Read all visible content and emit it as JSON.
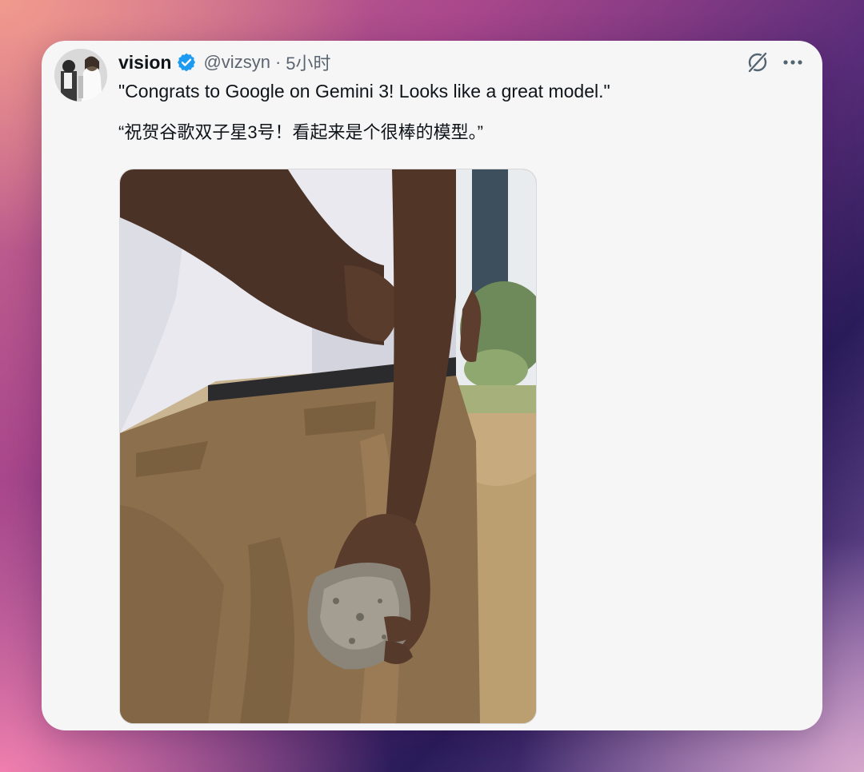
{
  "tweet": {
    "author": {
      "display_name": "vision",
      "handle": "@vizsyn",
      "verified": true
    },
    "separator": "·",
    "time": "5小时",
    "text_en": "\"Congrats to Google on Gemini 3! Looks like a great model.\"",
    "text_zh": "“祝贺谷歌双子星3号！看起来是个很棒的模型。”"
  },
  "icons": {
    "verified": "verified-badge-icon",
    "grok": "grok-icon",
    "more": "more-options-icon"
  },
  "colors": {
    "verified_blue": "#1d9bf0",
    "text_primary": "#0f1419",
    "text_secondary": "#5b6570",
    "card_bg": "#f6f6f7"
  }
}
